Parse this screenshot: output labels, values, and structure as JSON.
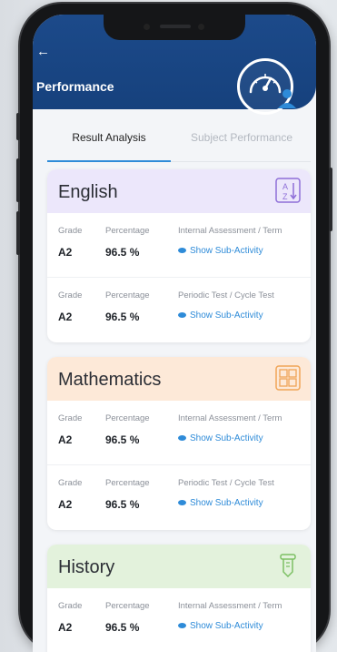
{
  "header": {
    "back_glyph": "←",
    "title": "Performance"
  },
  "tabs": [
    {
      "label": "Result Analysis"
    },
    {
      "label": "Subject Performance"
    }
  ],
  "subjects": [
    {
      "name": "English",
      "head_color": "#ece7fb",
      "icon_color": "#8e6fd8",
      "icon": "sort-az-icon",
      "rows": [
        {
          "grade_label": "Grade",
          "grade": "A2",
          "pct_label": "Percentage",
          "pct": "96.5 %",
          "assessment": "Internal Assessment / Term",
          "link": "Show Sub-Activity"
        },
        {
          "grade_label": "Grade",
          "grade": "A2",
          "pct_label": "Percentage",
          "pct": "96.5 %",
          "assessment": "Periodic Test / Cycle Test",
          "link": "Show Sub-Activity"
        }
      ]
    },
    {
      "name": "Mathematics",
      "head_color": "#fde9d8",
      "icon_color": "#f0a557",
      "icon": "calculator-icon",
      "rows": [
        {
          "grade_label": "Grade",
          "grade": "A2",
          "pct_label": "Percentage",
          "pct": "96.5 %",
          "assessment": "Internal Assessment / Term",
          "link": "Show Sub-Activity"
        },
        {
          "grade_label": "Grade",
          "grade": "A2",
          "pct_label": "Percentage",
          "pct": "96.5 %",
          "assessment": "Periodic Test / Cycle Test",
          "link": "Show Sub-Activity"
        }
      ]
    },
    {
      "name": "History",
      "head_color": "#e3f2dc",
      "icon_color": "#7cc063",
      "icon": "scroll-icon",
      "rows": [
        {
          "grade_label": "Grade",
          "grade": "A2",
          "pct_label": "Percentage",
          "pct": "96.5 %",
          "assessment": "Internal Assessment / Term",
          "link": "Show Sub-Activity"
        }
      ]
    }
  ],
  "colors": {
    "header_bg": "#1c4a8a",
    "accent": "#2e8bd8"
  }
}
